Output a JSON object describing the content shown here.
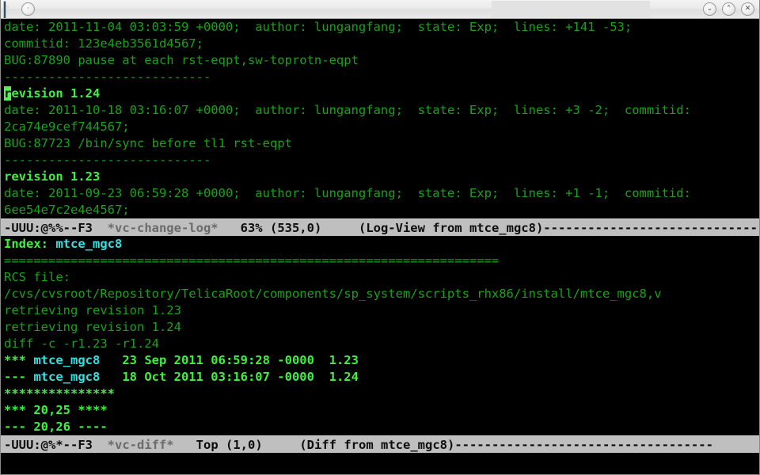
{
  "titlebar": {
    "app_icon": "terminal-icon",
    "menu_icon": "circle-button-icon",
    "minimize_label": "⌄",
    "maximize_label": "⌃",
    "close_label": "✕",
    "title": ""
  },
  "log_buffer": {
    "lines": [
      [
        {
          "t": "date: 2011-11-04 03:03:59 +0000;  author: lungangfang;  state: Exp;  lines: +141 -53;",
          "c": "g-norm"
        }
      ],
      [
        {
          "t": "commitid: 123e4eb3561d4567;",
          "c": "g-norm"
        }
      ],
      [
        {
          "t": "BUG:87890 pause at each rst-eqpt,sw-toprotn-eqpt",
          "c": "g-norm"
        }
      ],
      [
        {
          "t": "----------------------------",
          "c": "g-norm"
        }
      ],
      [
        {
          "t": "r",
          "c": "cursor"
        },
        {
          "t": "evision 1.24",
          "c": "g-bold"
        }
      ],
      [
        {
          "t": "date: 2011-10-18 03:16:07 +0000;  author: lungangfang;  state: Exp;  lines: +3 -2;  commitid:",
          "c": "g-norm"
        }
      ],
      [
        {
          "t": "2ca74e9cef744567;",
          "c": "g-norm"
        }
      ],
      [
        {
          "t": "BUG:87723 /bin/sync before tl1 rst-eqpt",
          "c": "g-norm"
        }
      ],
      [
        {
          "t": "----------------------------",
          "c": "g-norm"
        }
      ],
      [
        {
          "t": "revision 1.23",
          "c": "g-bold"
        }
      ],
      [
        {
          "t": "date: 2011-09-23 06:59:28 +0000;  author: lungangfang;  state: Exp;  lines: +1 -1;  commitid:",
          "c": "g-norm"
        }
      ],
      [
        {
          "t": "6ee54e7c2e4e4567;",
          "c": "g-norm"
        }
      ]
    ],
    "modeline": {
      "flags": "-UUU:@%%--F3",
      "buffer_name": "*vc-change-log*",
      "position_percent": "63%",
      "position_point": "(535,0)",
      "mode_info": "(Log-View from mtce_mgc8)",
      "filler": "-------------------------------"
    }
  },
  "diff_buffer": {
    "lines": [
      [
        {
          "t": "Index: ",
          "c": "g-bold"
        },
        {
          "t": "mtce_mgc8",
          "c": "cyan"
        }
      ],
      [
        {
          "t": "===================================================================",
          "c": "g-norm"
        }
      ],
      [
        {
          "t": "RCS file:",
          "c": "g-norm"
        }
      ],
      [
        {
          "t": "/cvs/cvsroot/Repository/TelicaRoot/components/sp_system/scripts_rhx86/install/mtce_mgc8,v",
          "c": "g-norm"
        }
      ],
      [
        {
          "t": "retrieving revision 1.23",
          "c": "g-norm"
        }
      ],
      [
        {
          "t": "retrieving revision 1.24",
          "c": "g-norm"
        }
      ],
      [
        {
          "t": "diff -c -r1.23 -r1.24",
          "c": "g-norm"
        }
      ],
      [
        {
          "t": "*** ",
          "c": "g-bold"
        },
        {
          "t": "mtce_mgc8",
          "c": "cyan"
        },
        {
          "t": "   23 Sep 2011 06:59:28 -0000  1.23",
          "c": "g-bold"
        }
      ],
      [
        {
          "t": "--- ",
          "c": "g-bold"
        },
        {
          "t": "mtce_mgc8",
          "c": "cyan"
        },
        {
          "t": "   18 Oct 2011 03:16:07 -0000  1.24",
          "c": "g-bold"
        }
      ],
      [
        {
          "t": "***************",
          "c": "g-bold"
        }
      ],
      [
        {
          "t": "*** 20,25 ****",
          "c": "g-bold"
        }
      ],
      [
        {
          "t": "--- 20,26 ----",
          "c": "g-bold"
        }
      ]
    ],
    "modeline": {
      "flags": "-UUU:@%*--F3",
      "buffer_name": "*vc-diff*",
      "position_percent": "Top",
      "position_point": "(1,0)",
      "mode_info": "(Diff from mtce_mgc8)",
      "filler": "-----------------------------------"
    }
  },
  "minibuffer": {
    "text": ""
  },
  "colors": {
    "background": "#000000",
    "foreground_green": "#17a317",
    "bright_green": "#3ff03f",
    "cyan": "#32e0e0",
    "modeline_bg": "#bfbfbf",
    "modeline_fg": "#101010",
    "cursor": "#55f055"
  }
}
